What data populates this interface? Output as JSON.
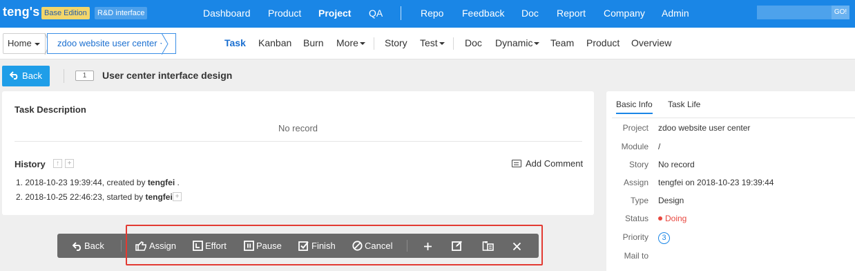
{
  "header": {
    "brand": "teng's",
    "edition_badge": "Base Edition",
    "interface_badge": "R&D interface",
    "nav": [
      "Dashboard",
      "Product",
      "Project",
      "QA",
      "Repo",
      "Feedback",
      "Doc",
      "Report",
      "Company",
      "Admin"
    ],
    "active_nav": "Project",
    "search_placeholder": "",
    "search_button": "GO!"
  },
  "breadcrumb": {
    "home": "Home",
    "project": "zdoo website user center"
  },
  "subnav": [
    "Task",
    "Kanban",
    "Burn",
    "More",
    "Story",
    "Test",
    "Doc",
    "Dynamic",
    "Team",
    "Product",
    "Overview"
  ],
  "task": {
    "back_label": "Back",
    "id": "1",
    "title": "User center interface design"
  },
  "main": {
    "description_heading": "Task Description",
    "description_value": "No record",
    "history_heading": "History",
    "add_comment": "Add Comment",
    "history": [
      {
        "prefix": "1. 2018-10-23 19:39:44, created by ",
        "user": "tengfei",
        "suffix": " ."
      },
      {
        "prefix": "2. 2018-10-25 22:46:23, started by ",
        "user": "tengfei",
        "suffix": "."
      }
    ]
  },
  "side": {
    "tabs": [
      "Basic Info",
      "Task Life"
    ],
    "rows": [
      {
        "label": "Project",
        "value": "zdoo website user center"
      },
      {
        "label": "Module",
        "value": "/"
      },
      {
        "label": "Story",
        "value": "No record"
      },
      {
        "label": "Assign",
        "value": "tengfei on 2018-10-23 19:39:44"
      },
      {
        "label": "Type",
        "value": "Design"
      },
      {
        "label": "Status",
        "value": "Doing"
      },
      {
        "label": "Priority",
        "value": "3"
      },
      {
        "label": "Mail to",
        "value": ""
      }
    ]
  },
  "toolbar": {
    "back": "Back",
    "assign": "Assign",
    "effort": "Effort",
    "pause": "Pause",
    "finish": "Finish",
    "cancel": "Cancel"
  },
  "colors": {
    "primary": "#1a86e6",
    "status_doing": "#e8473f",
    "highlight": "#e23a32",
    "toolbar_bg": "#696969"
  }
}
